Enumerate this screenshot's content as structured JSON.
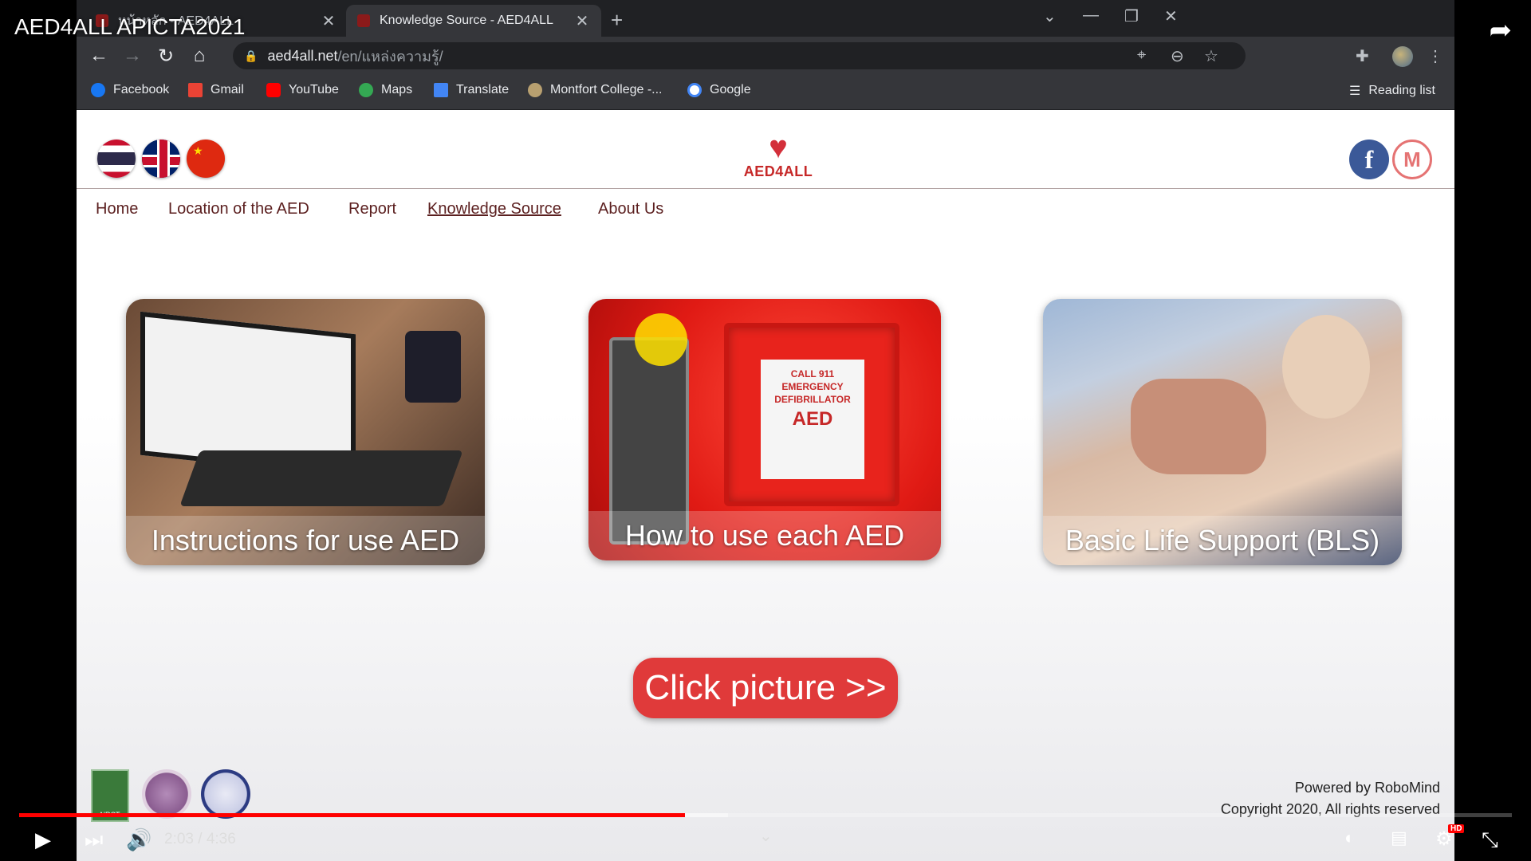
{
  "video": {
    "title": "AED4ALL APICTA2021",
    "time_current": "2:03",
    "time_sep": "/",
    "time_total": "4:36",
    "progress": 0.446,
    "buffered": 0.475
  },
  "browser": {
    "tabs": [
      {
        "label": "หน้าหลัก - AED4ALL",
        "active": false
      },
      {
        "label": "Knowledge Source - AED4ALL",
        "active": true
      }
    ],
    "url_host": "aed4all.net",
    "url_path": "/en/แหล่งความรู้/",
    "bookmarks": [
      {
        "label": "Facebook",
        "icon": "facebook-icon",
        "color": "#1877f2"
      },
      {
        "label": "Gmail",
        "icon": "gmail-icon",
        "color": "#ea4335"
      },
      {
        "label": "YouTube",
        "icon": "youtube-icon",
        "color": "#ff0000"
      },
      {
        "label": "Maps",
        "icon": "maps-icon",
        "color": "#34a853"
      },
      {
        "label": "Translate",
        "icon": "translate-icon",
        "color": "#4285f4"
      },
      {
        "label": "Montfort College -...",
        "icon": "montfort-icon",
        "color": "#b8a070"
      },
      {
        "label": "Google",
        "icon": "google-icon",
        "color": "#ffffff"
      }
    ],
    "reading_list": "Reading list"
  },
  "site": {
    "logo_text": "AED4ALL",
    "nav": [
      {
        "label": "Home",
        "current": false
      },
      {
        "label": "Location of the AED",
        "current": false
      },
      {
        "label": "Report",
        "current": false
      },
      {
        "label": "Knowledge Source",
        "current": true
      },
      {
        "label": "About Us",
        "current": false
      }
    ],
    "cards": [
      {
        "label": "Instructions for use AED"
      },
      {
        "label": "How to use each AED",
        "sign_line1": "CALL 911",
        "sign_line2": "EMERGENCY DEFIBRILLATOR",
        "sign_line3": "AED"
      },
      {
        "label": "Basic Life Support (BLS)"
      }
    ],
    "cta": "Click picture >>",
    "footer_powered": "Powered by RoboMind",
    "footer_copyright": "Copyright 2020, All rights reserved",
    "partner_1_text": "NRCT"
  },
  "colors": {
    "brand_red": "#c62828",
    "nav_text": "#5b1f1f",
    "progress_red": "#ff0000"
  }
}
